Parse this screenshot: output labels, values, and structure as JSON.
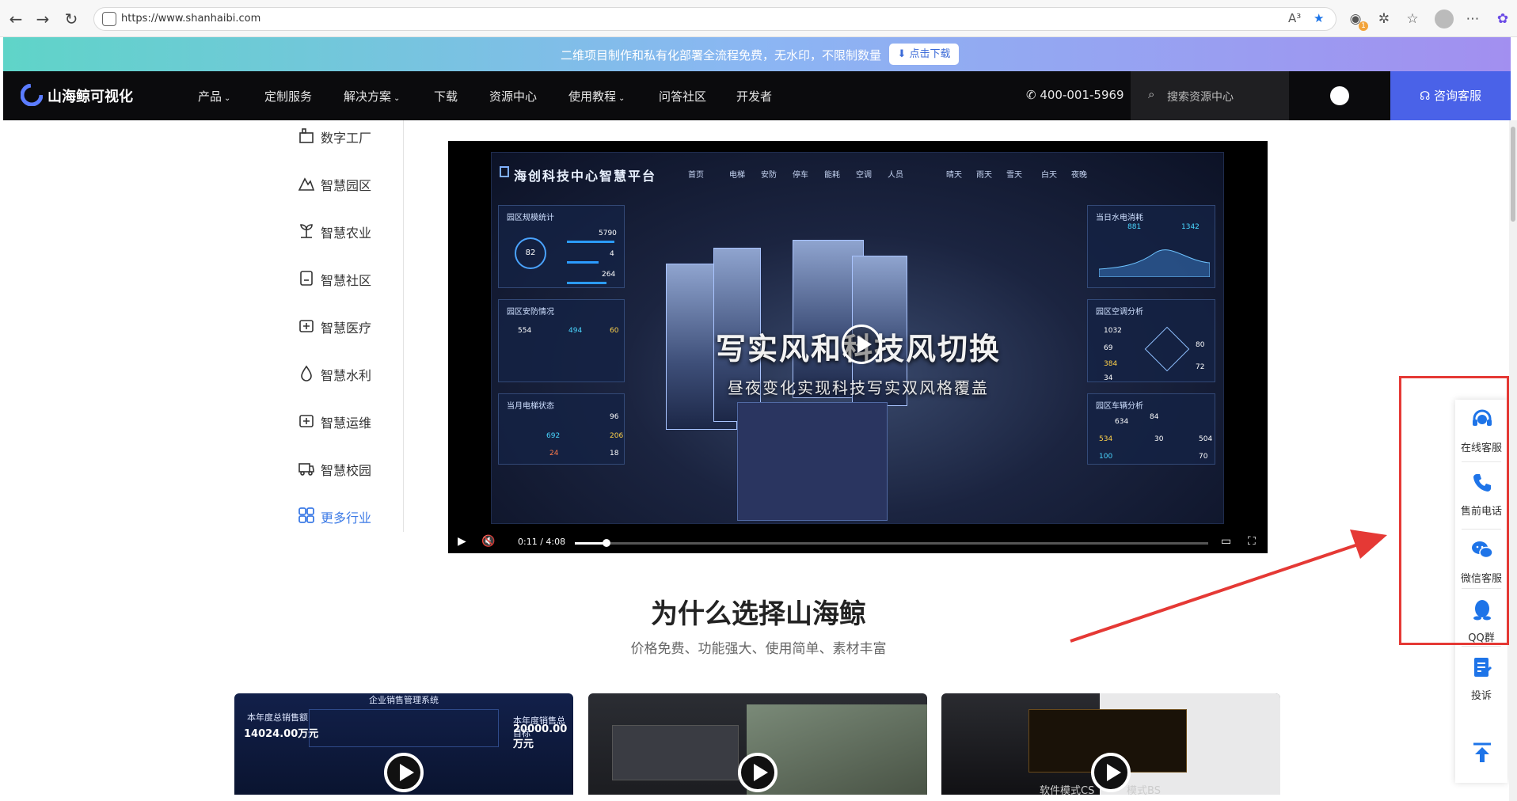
{
  "browser": {
    "url": "https://www.shanhaibi.com",
    "read_aloud": "A³",
    "ext_badge": "1"
  },
  "promo": {
    "text": "二维项目制作和私有化部署全流程免费，无水印，不限制数量",
    "button": "点击下载"
  },
  "header": {
    "logo": "山海鲸可视化",
    "nav": [
      {
        "label": "产品",
        "dropdown": true
      },
      {
        "label": "定制服务",
        "dropdown": false
      },
      {
        "label": "解决方案",
        "dropdown": true
      },
      {
        "label": "下载",
        "dropdown": false
      },
      {
        "label": "资源中心",
        "dropdown": false
      },
      {
        "label": "使用教程",
        "dropdown": true
      },
      {
        "label": "问答社区",
        "dropdown": false
      },
      {
        "label": "开发者",
        "dropdown": false
      }
    ],
    "phone": "400-001-5969",
    "search_placeholder": "搜索资源中心",
    "consult": "咨询客服"
  },
  "industries": [
    {
      "label": "数字工厂",
      "icon": "factory-icon"
    },
    {
      "label": "智慧园区",
      "icon": "park-icon"
    },
    {
      "label": "智慧农业",
      "icon": "agriculture-icon"
    },
    {
      "label": "智慧社区",
      "icon": "community-icon"
    },
    {
      "label": "智慧医疗",
      "icon": "medical-icon"
    },
    {
      "label": "智慧水利",
      "icon": "water-icon"
    },
    {
      "label": "智慧运维",
      "icon": "maintenance-icon"
    },
    {
      "label": "智慧校园",
      "icon": "campus-icon"
    },
    {
      "label": "更多行业",
      "icon": "grid-icon"
    }
  ],
  "video": {
    "platform_title": "海创科技中心智慧平台",
    "tabs": [
      "首页",
      "电梯",
      "安防",
      "停车",
      "能耗",
      "空调",
      "人员"
    ],
    "weather": [
      "晴天",
      "雨天",
      "雪天",
      "白天",
      "夜晚"
    ],
    "panel_left_1": "园区规模统计",
    "panel_left_2": "园区安防情况",
    "panel_left_3": "当月电梯状态",
    "panel_right_1": "当日水电消耗",
    "panel_right_2": "园区空调分析",
    "panel_right_3": "园区车辆分析",
    "stat_values": [
      "5790",
      "4",
      "264",
      "881",
      "1342",
      "554",
      "494",
      "60",
      "96",
      "692",
      "206",
      "24",
      "18",
      "634",
      "84",
      "534",
      "30",
      "504",
      "100",
      "70",
      "1032",
      "69",
      "384",
      "34",
      "80",
      "72"
    ],
    "gauge": "82",
    "headline": "写实风和科技风切换",
    "subtitle": "昼夜变化实现科技写实双风格覆盖",
    "time": "0:11 / 4:08",
    "progress": 0.05
  },
  "section": {
    "title": "为什么选择山海鲸",
    "subtitle": "价格免费、功能强大、使用简单、素材丰富"
  },
  "thumbs": [
    {
      "labels": [
        "企业销售管理系统",
        "本年度总销售额",
        "14024.00万元",
        "本年度销售总目标",
        "20000.00万元"
      ]
    },
    {
      "labels": []
    },
    {
      "labels": [
        "软件模式CS",
        "模式BS"
      ]
    }
  ],
  "side_widget": [
    {
      "label": "在线客服",
      "icon": "headset-icon"
    },
    {
      "label": "售前电话",
      "icon": "phone-icon"
    },
    {
      "label": "微信客服",
      "icon": "wechat-icon"
    },
    {
      "label": "QQ群",
      "icon": "qq-icon"
    },
    {
      "label": "投诉",
      "icon": "complaint-icon"
    },
    {
      "label": "",
      "icon": "back-to-top-icon"
    }
  ],
  "colors": {
    "accent": "#4a62e8",
    "header_bg": "#0b0b0d",
    "highlight": "#e53935",
    "link": "#3d7be6"
  }
}
